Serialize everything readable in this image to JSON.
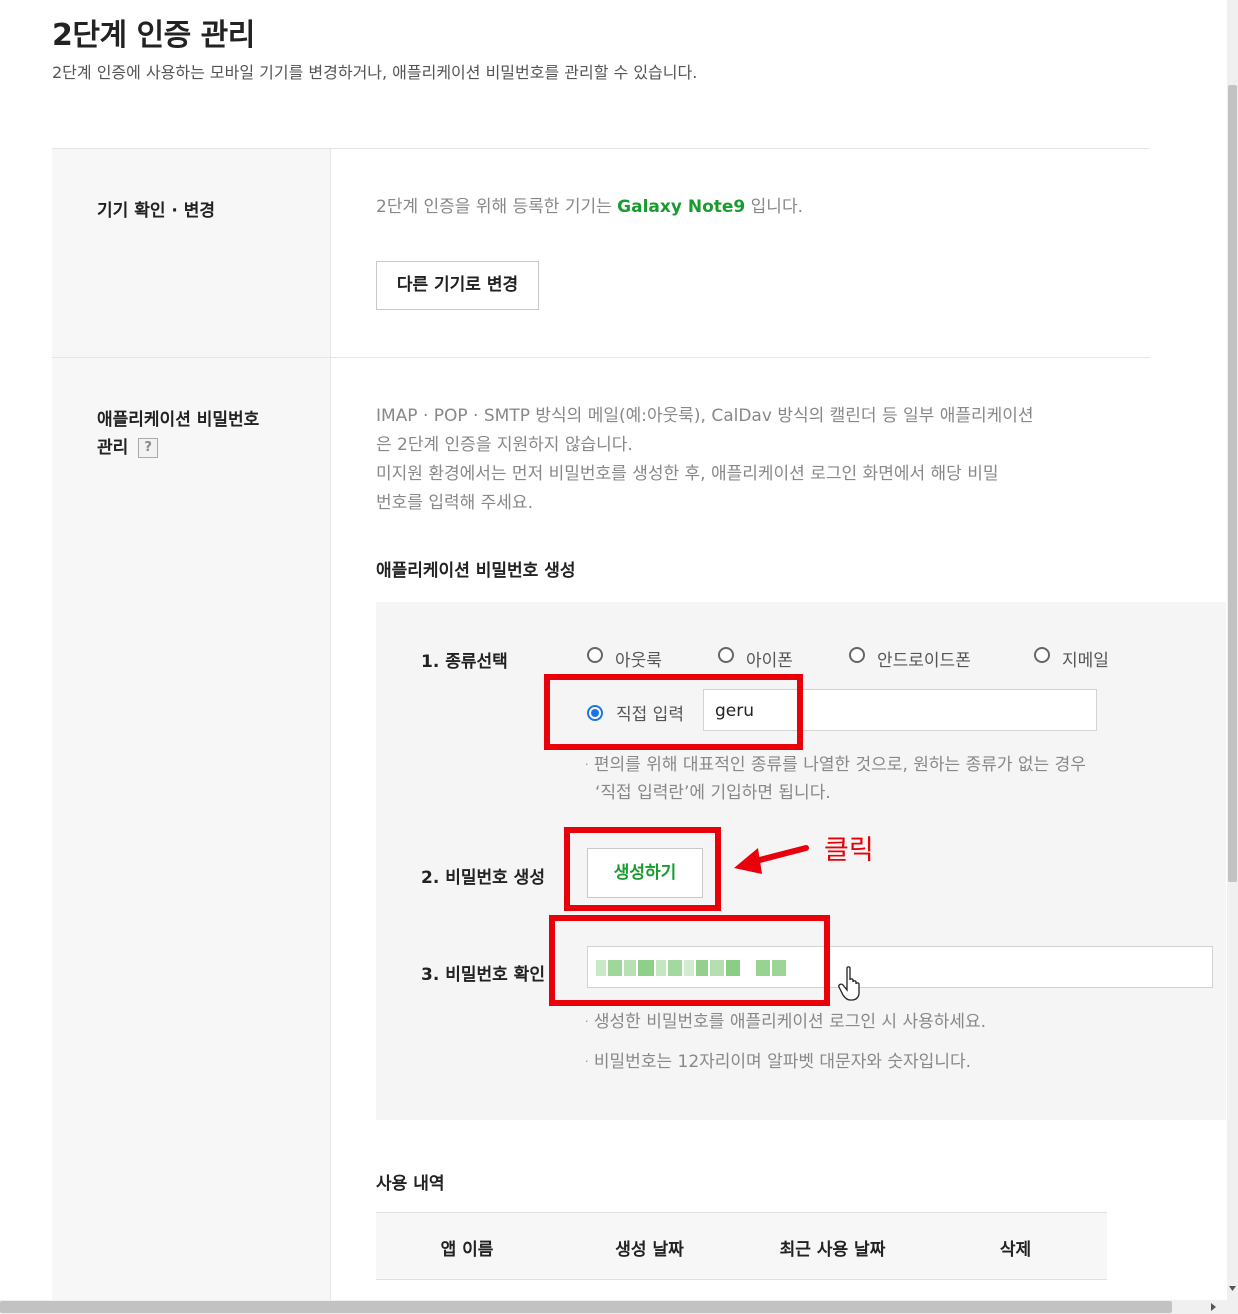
{
  "header": {
    "title": "2단계 인증 관리",
    "description": "2단계 인증에 사용하는 모바일 기기를 변경하거나, 애플리케이션 비밀번호를 관리할 수 있습니다."
  },
  "device_section": {
    "label": "기기 확인 · 변경",
    "info_prefix": "2단계 인증을 위해 등록한 기기는",
    "device_name": "Galaxy Note9",
    "info_suffix": "입니다.",
    "change_button": "다른 기기로 변경"
  },
  "app_password_section": {
    "label_line1": "애플리케이션 비밀번호",
    "label_line2": "관리",
    "help_icon": "?",
    "desc_lines": [
      "IMAP · POP · SMTP 방식의 메일(예:아웃룩), CalDav 방식의 캘린더 등 일부 애플리케이션",
      "은 2단계 인증을 지원하지 않습니다.",
      "미지원 환경에서는 먼저 비밀번호를 생성한 후, 애플리케이션 로그인 화면에서 해당 비밀",
      "번호를 입력해 주세요."
    ],
    "generate_title": "애플리케이션 비밀번호 생성",
    "step1_label": "1. 종류선택",
    "options": [
      "아웃룩",
      "아이폰",
      "안드로이드폰",
      "지메일"
    ],
    "direct_input_label": "직접 입력",
    "direct_input_value": "geru",
    "step1_note_line1": "편의를 위해 대표적인 종류를 나열한 것으로, 원하는 종류가 없는 경우",
    "step1_note_line2": "‘직접 입력란’에 기입하면 됩니다.",
    "step2_label": "2. 비밀번호 생성",
    "generate_button": "생성하기",
    "annotation_text": "클릭",
    "step3_label": "3. 비밀번호 확인",
    "note_use": "생성한 비밀번호를 애플리케이션 로그인 시 사용하세요.",
    "note_format": "비밀번호는 12자리이며 알파벳 대문자와 숫자입니다."
  },
  "usage_history": {
    "title": "사용 내역",
    "columns": [
      "앱 이름",
      "생성 날짜",
      "최근 사용 날짜",
      "삭제"
    ]
  },
  "colors": {
    "accent_green": "#1a9b2f",
    "annotation_red": "#e8000b",
    "radio_blue": "#1a73e8"
  }
}
